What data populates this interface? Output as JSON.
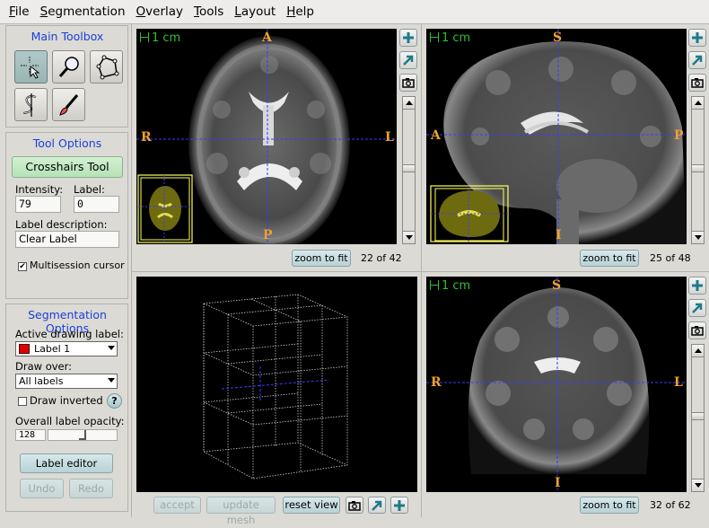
{
  "menu": [
    "File",
    "Segmentation",
    "Overlay",
    "Tools",
    "Layout",
    "Help"
  ],
  "main_toolbox": {
    "title": "Main Toolbox"
  },
  "tool_options": {
    "title": "Tool Options",
    "tool_name": "Crosshairs Tool",
    "intensity_label": "Intensity:",
    "intensity_value": "79",
    "label_label": "Label:",
    "label_value": "0",
    "desc_label": "Label description:",
    "desc_value": "Clear Label",
    "multisession_label": "Multisession cursor",
    "multisession_checked": true
  },
  "seg_options": {
    "title": "Segmentation Options",
    "active_label_caption": "Active drawing label:",
    "active_label_value": "Label 1",
    "active_label_color": "#e00000",
    "draw_over_caption": "Draw over:",
    "draw_over_value": "All labels",
    "draw_inverted_label": "Draw inverted",
    "help_glyph": "?",
    "opacity_caption": "Overall label opacity:",
    "opacity_value": "128",
    "label_editor": "Label editor",
    "undo": "Undo",
    "redo": "Redo"
  },
  "views": {
    "axial": {
      "scale": "1 cm",
      "top": "A",
      "bottom": "P",
      "left": "R",
      "right": "L",
      "zoom": "zoom to fit",
      "slice": "22 of 42"
    },
    "sagittal": {
      "scale": "1 cm",
      "top": "S",
      "bottom": "I",
      "left": "A",
      "right": "P",
      "zoom": "zoom to fit",
      "slice": "25 of 48"
    },
    "coronal": {
      "scale": "1 cm",
      "top": "S",
      "bottom": "I",
      "left": "R",
      "right": "L",
      "zoom": "zoom to fit",
      "slice": "32 of 62"
    },
    "render3d": {
      "accept": "accept",
      "update_mesh": "update mesh",
      "reset_view": "reset view"
    }
  },
  "colors": {
    "accent_title": "#1a3fd9",
    "orientation": "#f0a22a",
    "scale_bar": "#30c030",
    "crosshair": "#3a3aff"
  }
}
